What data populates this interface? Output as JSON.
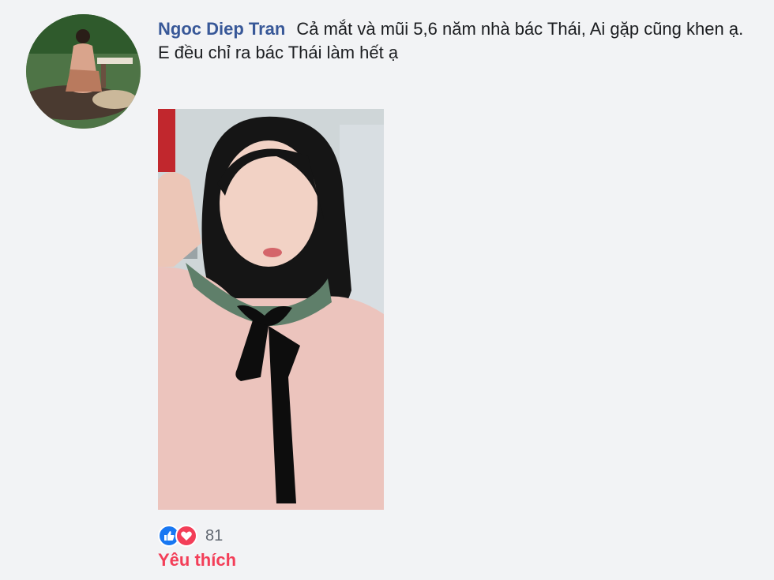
{
  "comment": {
    "author": "Ngoc Diep Tran",
    "text": "Cả mắt và mũi 5,6 năm nhà bác Thái, Ai gặp cũng khen ạ. E đều chỉ ra bác Thái làm hết ạ"
  },
  "reactions": {
    "icons": [
      "like-icon",
      "love-icon"
    ],
    "count": "81",
    "action_label": "Yêu thích"
  },
  "colors": {
    "author": "#385898",
    "like": "#1877f2",
    "love": "#f33e58",
    "text": "#1c1e21"
  }
}
